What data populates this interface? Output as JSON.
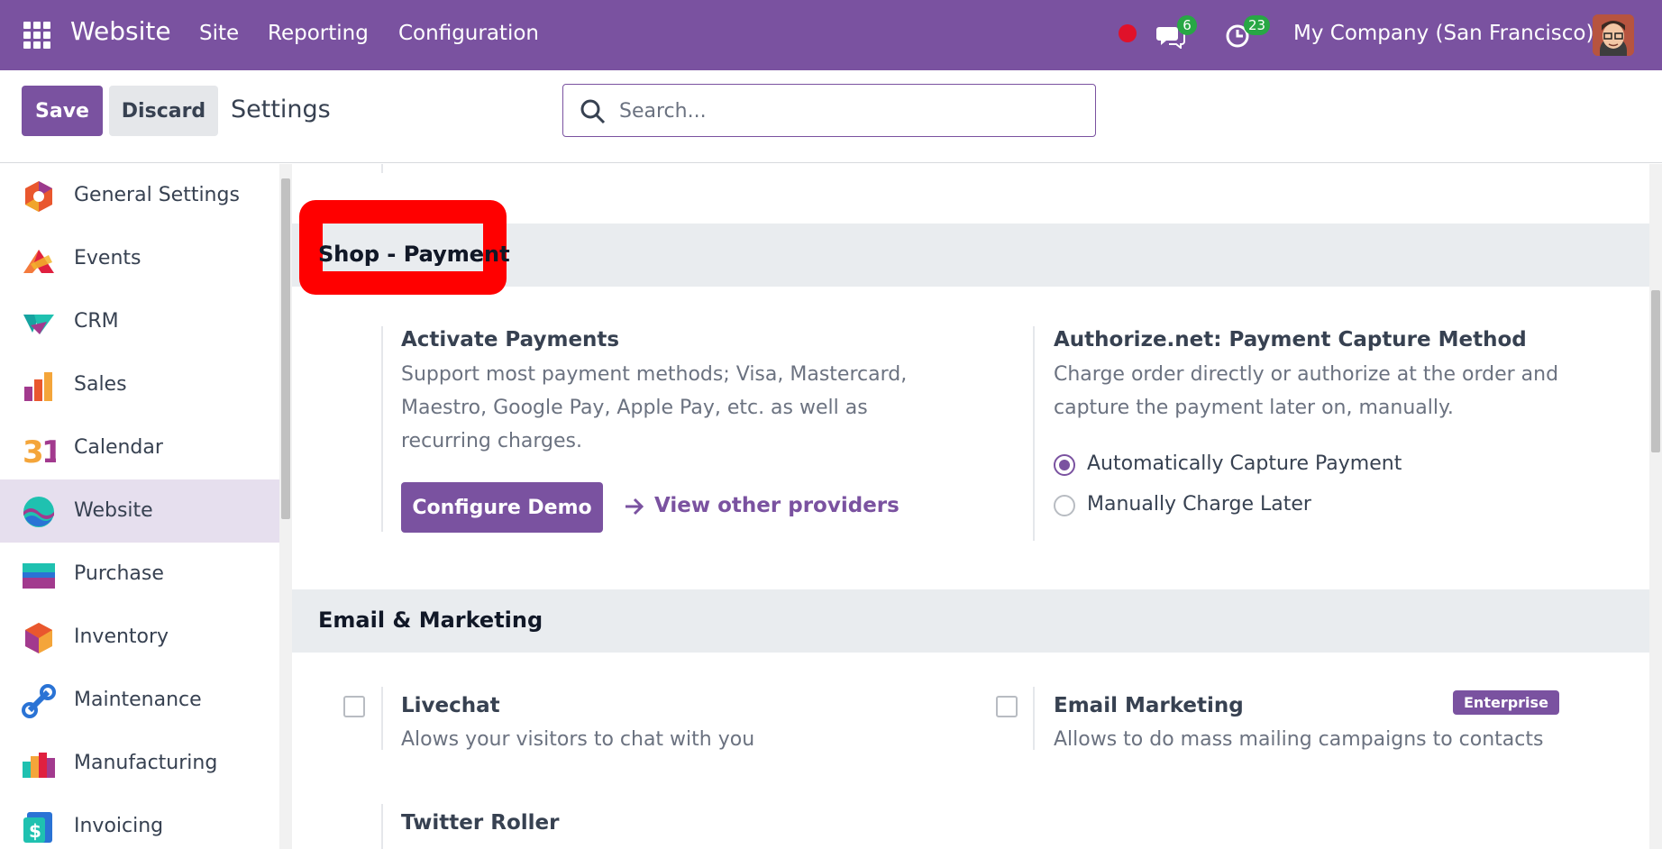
{
  "navbar": {
    "brand": "Website",
    "menu": [
      "Site",
      "Reporting",
      "Configuration"
    ],
    "chat_count": "6",
    "activity_count": "23",
    "company": "My Company (San Francisco)"
  },
  "control": {
    "save_label": "Save",
    "discard_label": "Discard",
    "title": "Settings",
    "search_placeholder": "Search..."
  },
  "sidebar": {
    "items": [
      {
        "label": "General Settings",
        "icon": "general-settings-icon"
      },
      {
        "label": "Events",
        "icon": "events-icon"
      },
      {
        "label": "CRM",
        "icon": "crm-icon"
      },
      {
        "label": "Sales",
        "icon": "sales-icon"
      },
      {
        "label": "Calendar",
        "icon": "calendar-icon"
      },
      {
        "label": "Website",
        "icon": "website-icon",
        "active": true
      },
      {
        "label": "Purchase",
        "icon": "purchase-icon"
      },
      {
        "label": "Inventory",
        "icon": "inventory-icon"
      },
      {
        "label": "Maintenance",
        "icon": "maintenance-icon"
      },
      {
        "label": "Manufacturing",
        "icon": "manufacturing-icon"
      },
      {
        "label": "Invoicing",
        "icon": "invoicing-icon"
      }
    ]
  },
  "main": {
    "shop_payment": {
      "title": "Shop - Payment",
      "activate": {
        "title": "Activate Payments",
        "desc": "Support most payment methods; Visa, Mastercard, Maestro, Google Pay, Apple Pay, etc. as well as recurring charges.",
        "button": "Configure Demo",
        "link": "View other providers"
      },
      "capture": {
        "title": "Authorize.net: Payment Capture Method",
        "desc": "Charge order directly or authorize at the order and capture the payment later on, manually.",
        "options": [
          "Automatically Capture Payment",
          "Manually Charge Later"
        ],
        "selected": "Automatically Capture Payment"
      }
    },
    "email_marketing": {
      "title": "Email & Marketing",
      "livechat": {
        "title": "Livechat",
        "desc": "Alows your visitors to chat with you"
      },
      "email_marketing": {
        "title": "Email Marketing",
        "badge": "Enterprise",
        "desc": "Allows to do mass mailing campaigns to contacts"
      },
      "twitter": {
        "title": "Twitter Roller"
      }
    }
  },
  "colors": {
    "brand": "#7a52a0",
    "highlight": "#ff0000",
    "badge": "#28a745"
  }
}
